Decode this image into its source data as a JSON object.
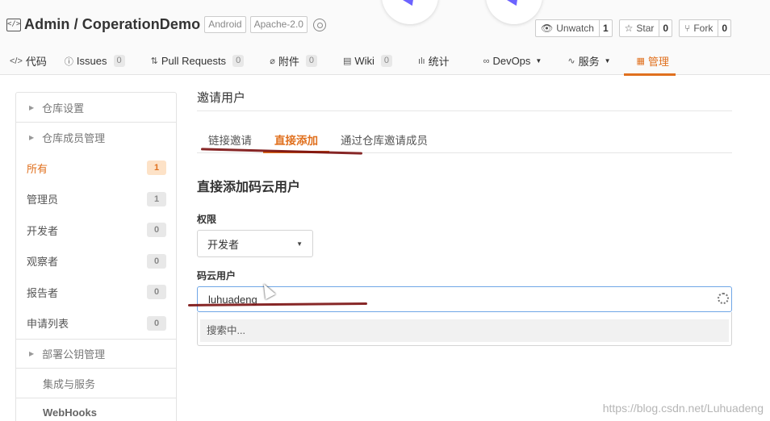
{
  "repo": {
    "icon": "code-repo-icon",
    "name": "Admin / CoperationDemo",
    "tags": [
      "Android",
      "Apache-2.0"
    ]
  },
  "actions": [
    {
      "icon": "eye-icon",
      "glyph": "👁",
      "label": "Unwatch",
      "count": "1"
    },
    {
      "icon": "star-icon",
      "glyph": "☆",
      "label": "Star",
      "count": "0"
    },
    {
      "icon": "fork-icon",
      "glyph": "⑂",
      "label": "Fork",
      "count": "0"
    }
  ],
  "nav": [
    {
      "icon": "code-icon",
      "glyph": "</>",
      "label": "代码"
    },
    {
      "icon": "issues-icon",
      "glyph": "ⓘ",
      "label": "Issues",
      "count": "0"
    },
    {
      "icon": "pull-request-icon",
      "glyph": "⇅",
      "label": "Pull Requests",
      "count": "0"
    },
    {
      "icon": "attachment-icon",
      "glyph": "⌀",
      "label": "附件",
      "count": "0"
    },
    {
      "icon": "wiki-icon",
      "glyph": "▤",
      "label": "Wiki",
      "count": "0"
    },
    {
      "icon": "stats-icon",
      "glyph": "ılı",
      "label": "统计"
    },
    {
      "icon": "devops-icon",
      "glyph": "∞",
      "label": "DevOps",
      "dropdown": true
    },
    {
      "icon": "service-icon",
      "glyph": "∿",
      "label": "服务",
      "dropdown": true
    },
    {
      "icon": "manage-icon",
      "glyph": "▦",
      "label": "管理",
      "active": true
    }
  ],
  "sidebar": {
    "repo_settings": "仓库设置",
    "member_management": "仓库成员管理",
    "members": [
      {
        "label": "所有",
        "count": "1",
        "active": true
      },
      {
        "label": "管理员",
        "count": "1"
      },
      {
        "label": "开发者",
        "count": "0"
      },
      {
        "label": "观察者",
        "count": "0"
      },
      {
        "label": "报告者",
        "count": "0"
      },
      {
        "label": "申请列表",
        "count": "0"
      }
    ],
    "deploy_keys": "部署公钥管理",
    "integrations": "集成与服务",
    "webhooks": "WebHooks"
  },
  "main": {
    "title": "邀请用户",
    "tabs": [
      {
        "label": "链接邀请"
      },
      {
        "label": "直接添加",
        "active": true
      },
      {
        "label": "通过仓库邀请成员"
      }
    ],
    "section_title": "直接添加码云用户",
    "permission_label": "权限",
    "permission_value": "开发者",
    "user_label": "码云用户",
    "user_value": "luhuadeng",
    "dropdown_status": "搜索中..."
  },
  "watermark": "https://blog.csdn.net/Luhuadeng",
  "colors": {
    "accent": "#e0701e",
    "focus_border": "#6fa6e6",
    "annotation": "#7a1010"
  }
}
